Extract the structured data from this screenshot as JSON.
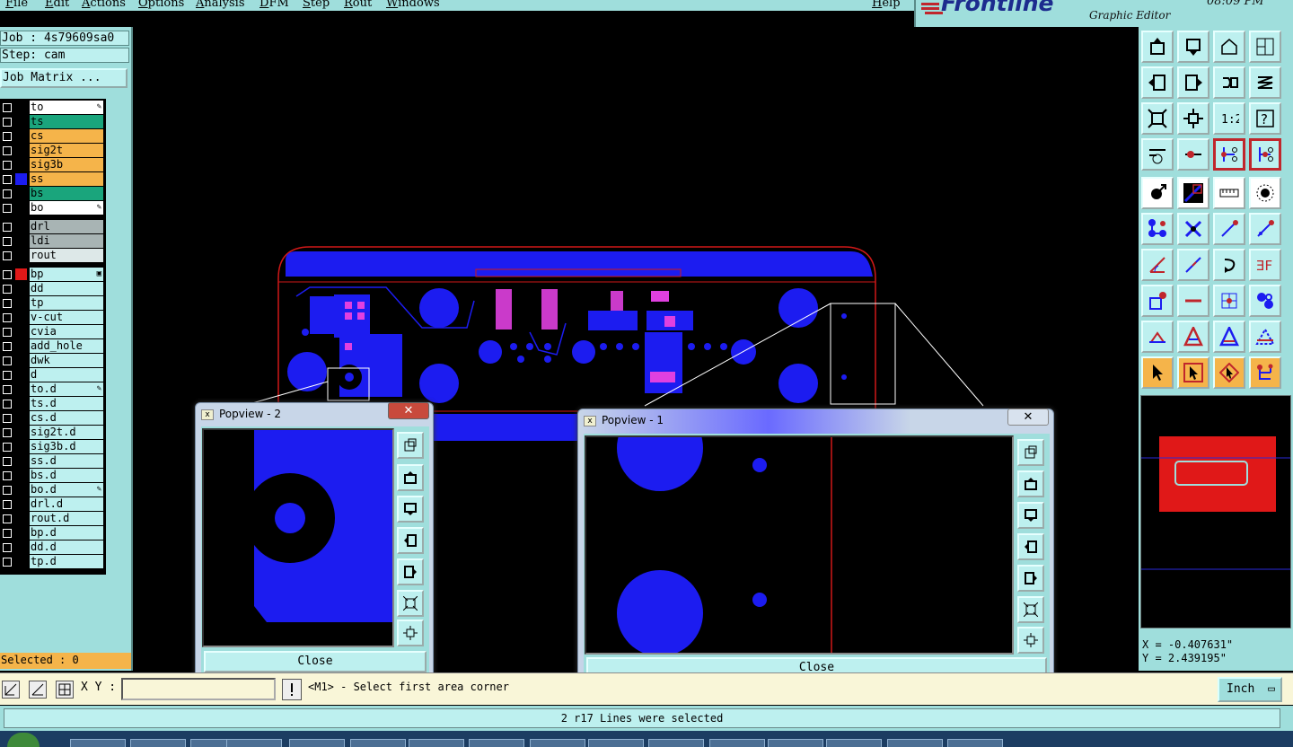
{
  "menu": {
    "items": [
      "File",
      "Edit",
      "Actions",
      "Options",
      "Analysis",
      "DFM",
      "Step",
      "Rout",
      "Windows"
    ],
    "help": "Help"
  },
  "logo": {
    "brand": "Frontline",
    "tagline": "Graphic Editor",
    "time": "08:09 PM"
  },
  "job": {
    "job_label": "Job : 4s79609sa0",
    "step_label": "Step: cam",
    "matrix_button": "Job Matrix ..."
  },
  "layers": [
    {
      "name": "to",
      "color": "#ffffff",
      "swatch": "",
      "mark": "✎"
    },
    {
      "name": "ts",
      "color": "#1aa57c",
      "swatch": "",
      "mark": ""
    },
    {
      "name": "cs",
      "color": "#f5b44a",
      "swatch": "",
      "mark": ""
    },
    {
      "name": "sig2t",
      "color": "#f5b44a",
      "swatch": "",
      "mark": ""
    },
    {
      "name": "sig3b",
      "color": "#f5b44a",
      "swatch": "",
      "mark": ""
    },
    {
      "name": "ss",
      "color": "#f5b44a",
      "swatch": "#1c1cf0",
      "mark": ""
    },
    {
      "name": "bs",
      "color": "#1aa57c",
      "swatch": "",
      "mark": ""
    },
    {
      "name": "bo",
      "color": "#ffffff",
      "swatch": "",
      "mark": "✎"
    },
    {
      "name": "drl",
      "color": "#a8b4b4",
      "swatch": "",
      "mark": ""
    },
    {
      "name": "ldi",
      "color": "#a8b4b4",
      "swatch": "",
      "mark": ""
    },
    {
      "name": "rout",
      "color": "#dde8e8",
      "swatch": "",
      "mark": ""
    },
    {
      "name": "bp",
      "color": "#bdf0ef",
      "swatch": "#e01818",
      "mark": "▣"
    },
    {
      "name": "dd",
      "color": "#bdf0ef",
      "swatch": "",
      "mark": ""
    },
    {
      "name": "tp",
      "color": "#bdf0ef",
      "swatch": "",
      "mark": ""
    },
    {
      "name": "v-cut",
      "color": "#bdf0ef",
      "swatch": "",
      "mark": ""
    },
    {
      "name": "cvia",
      "color": "#bdf0ef",
      "swatch": "",
      "mark": ""
    },
    {
      "name": "add_hole",
      "color": "#bdf0ef",
      "swatch": "",
      "mark": ""
    },
    {
      "name": "dwk",
      "color": "#bdf0ef",
      "swatch": "",
      "mark": ""
    },
    {
      "name": "d",
      "color": "#bdf0ef",
      "swatch": "",
      "mark": ""
    },
    {
      "name": "to.d",
      "color": "#bdf0ef",
      "swatch": "",
      "mark": "✎"
    },
    {
      "name": "ts.d",
      "color": "#bdf0ef",
      "swatch": "",
      "mark": ""
    },
    {
      "name": "cs.d",
      "color": "#bdf0ef",
      "swatch": "",
      "mark": ""
    },
    {
      "name": "sig2t.d",
      "color": "#bdf0ef",
      "swatch": "",
      "mark": ""
    },
    {
      "name": "sig3b.d",
      "color": "#bdf0ef",
      "swatch": "",
      "mark": ""
    },
    {
      "name": "ss.d",
      "color": "#bdf0ef",
      "swatch": "",
      "mark": ""
    },
    {
      "name": "bs.d",
      "color": "#bdf0ef",
      "swatch": "",
      "mark": ""
    },
    {
      "name": "bo.d",
      "color": "#bdf0ef",
      "swatch": "",
      "mark": "✎"
    },
    {
      "name": "drl.d",
      "color": "#bdf0ef",
      "swatch": "",
      "mark": ""
    },
    {
      "name": "rout.d",
      "color": "#bdf0ef",
      "swatch": "",
      "mark": ""
    },
    {
      "name": "bp.d",
      "color": "#bdf0ef",
      "swatch": "",
      "mark": ""
    },
    {
      "name": "dd.d",
      "color": "#bdf0ef",
      "swatch": "",
      "mark": ""
    },
    {
      "name": "tp.d",
      "color": "#bdf0ef",
      "swatch": "",
      "mark": ""
    }
  ],
  "selected_label": "Selected : 0",
  "popup2": {
    "title": "Popview - 2",
    "close_label": "Close"
  },
  "popup1": {
    "title": "Popview - 1",
    "close_label": "Close"
  },
  "coords": {
    "x": "X = -0.407631\"",
    "y": "Y = 2.439195\""
  },
  "bottom": {
    "xy_label": "X Y :",
    "xy_value": "",
    "prompt": "<M1> - Select first area corner",
    "units": "Inch"
  },
  "status": "2 r17 Lines were selected",
  "tools": {
    "rows": [
      [
        "window-up-icon",
        "window-down-icon",
        "home-icon",
        "split-view-icon"
      ],
      [
        "pan-left-icon",
        "pan-right-icon",
        "undo-view-icon",
        "redraw-icon"
      ],
      [
        "zoom-fit-icon",
        "zoom-home-icon",
        "zoom-1to1-icon",
        "help-icon"
      ],
      [
        "snap-settings-icon",
        "probe-icon",
        "route-net-icon",
        "route-layers-icon"
      ],
      [
        "select-point-icon",
        "select-slash-icon",
        "measure-icon",
        "select-circle-icon"
      ],
      [
        "net-nodes-icon",
        "cross-select-icon",
        "arrow-point-icon",
        "arrow-point-2-icon"
      ],
      [
        "angle-icon",
        "diagonal-icon",
        "rotate-icon",
        "mirror-ff-icon"
      ],
      [
        "pad-select-icon",
        "line-select-icon",
        "grid-select-icon",
        "cluster-icon"
      ],
      [
        "triangle-small-icon",
        "triangle-large-icon",
        "triangle-outline-icon",
        "triangle-dashed-icon"
      ],
      [
        "pointer-icon",
        "pointer-box-icon",
        "pointer-diamond-icon",
        "tree-icon"
      ]
    ]
  }
}
